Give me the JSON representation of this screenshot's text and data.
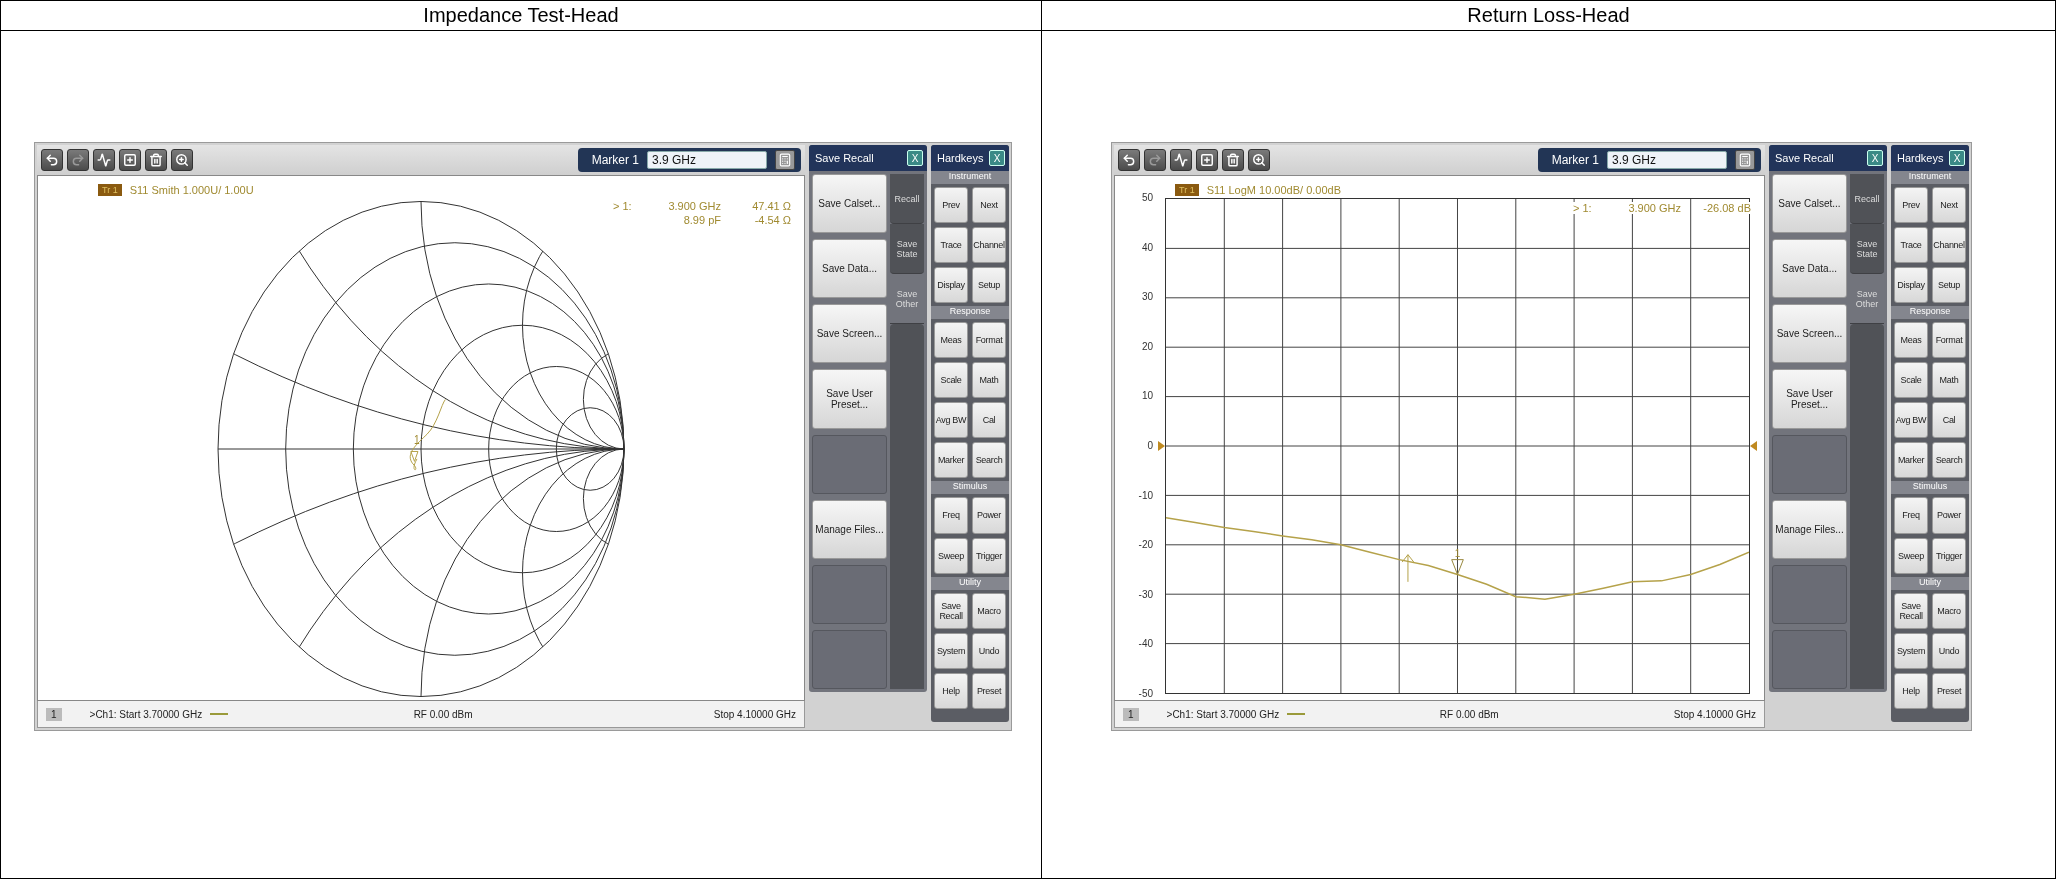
{
  "table": {
    "columns": [
      {
        "heading": "Impedance Test-Head",
        "screen": {
          "marker_label": "Marker 1",
          "marker_value": "3.9 GHz",
          "trace_tag": "Tr 1",
          "trace_title": "S11 Smith 1.000U/ 1.00U",
          "readout": [
            {
              "marker": "> 1:",
              "stimulus": "3.900  GHz",
              "value": "47.41 Ω"
            },
            {
              "stimulus": "8.99 pF",
              "value": "-4.54 Ω"
            }
          ],
          "display": {
            "kind": "smith",
            "marker_id": "1"
          },
          "status": {
            "channel": "1",
            "start": ">Ch1:  Start  3.70000 GHz",
            "rf": "RF   0.00 dBm",
            "stop": "Stop  4.10000 GHz"
          },
          "save_recall": {
            "title": "Save Recall",
            "close": "X",
            "buttons": [
              {
                "kind": "label",
                "label": "Save Calset..."
              },
              {
                "kind": "label",
                "label": "Save Data..."
              },
              {
                "kind": "label",
                "label": "Save Screen..."
              },
              {
                "kind": "label",
                "label": "Save User Preset..."
              },
              {
                "kind": "blank"
              },
              {
                "kind": "label",
                "label": "Manage Files..."
              },
              {
                "kind": "blank"
              },
              {
                "kind": "blank"
              }
            ],
            "tabs": [
              {
                "label": "Recall",
                "selected": false
              },
              {
                "label": "Save State",
                "selected": false
              },
              {
                "label": "Save Other",
                "selected": true
              }
            ]
          },
          "hardkeys": {
            "title": "Hardkeys",
            "close": "X",
            "groups": [
              {
                "name": "Instrument",
                "keys": [
                  "Prev",
                  "Next",
                  "Trace",
                  "Channel",
                  "Display",
                  "Setup"
                ]
              },
              {
                "name": "Response",
                "keys": [
                  "Meas",
                  "Format",
                  "Scale",
                  "Math",
                  "Avg BW",
                  "Cal",
                  "Marker",
                  "Search"
                ]
              },
              {
                "name": "Stimulus",
                "keys": [
                  "Freq",
                  "Power",
                  "Sweep",
                  "Trigger"
                ]
              },
              {
                "name": "Utility",
                "keys": [
                  "Save Recall",
                  "Macro",
                  "System",
                  "Undo",
                  "Help",
                  "Preset"
                ]
              }
            ]
          }
        }
      },
      {
        "heading": "Return Loss-Head",
        "screen": {
          "marker_label": "Marker 1",
          "marker_value": "3.9 GHz",
          "trace_tag": "Tr 1",
          "trace_title": "S11 LogM 10.00dB/ 0.00dB",
          "readout": [
            {
              "marker": "> 1:",
              "stimulus": "3.900  GHz",
              "value": "-26.08 dB"
            }
          ],
          "display": {
            "kind": "logmag",
            "marker_id": "1",
            "chart_data": {
              "type": "line",
              "categories": [
                null,
                null,
                null,
                null,
                null,
                null,
                null,
                null,
                null,
                null,
                null,
                null,
                null,
                null,
                null,
                null,
                null,
                null,
                null,
                null,
                null
              ],
              "series": [
                {
                  "color": "#b5a24a",
                  "values": [
                    -14.5,
                    -15.5,
                    -16.5,
                    -17.3,
                    -18.2,
                    -19,
                    -20,
                    -21.5,
                    -23,
                    -24.2,
                    -26,
                    -28,
                    -30.5,
                    -31,
                    -30,
                    -28.8,
                    -27.5,
                    -27.3,
                    -26,
                    -24,
                    -21.5
                  ]
                }
              ],
              "grid": true,
              "ylim": [
                -50,
                50
              ],
              "yticks": [
                50,
                40,
                30,
                20,
                10,
                0,
                -10,
                -20,
                -30,
                -40,
                -50
              ]
            }
          },
          "status": {
            "channel": "1",
            "start": ">Ch1:  Start  3.70000 GHz",
            "rf": "RF   0.00 dBm",
            "stop": "Stop  4.10000 GHz"
          },
          "save_recall": {
            "title": "Save Recall",
            "close": "X",
            "buttons": [
              {
                "kind": "label",
                "label": "Save Calset..."
              },
              {
                "kind": "label",
                "label": "Save Data..."
              },
              {
                "kind": "label",
                "label": "Save Screen..."
              },
              {
                "kind": "label",
                "label": "Save User Preset..."
              },
              {
                "kind": "blank"
              },
              {
                "kind": "label",
                "label": "Manage Files..."
              },
              {
                "kind": "blank"
              },
              {
                "kind": "blank"
              }
            ],
            "tabs": [
              {
                "label": "Recall",
                "selected": false
              },
              {
                "label": "Save State",
                "selected": false
              },
              {
                "label": "Save Other",
                "selected": true
              }
            ]
          },
          "hardkeys": {
            "title": "Hardkeys",
            "close": "X",
            "groups": [
              {
                "name": "Instrument",
                "keys": [
                  "Prev",
                  "Next",
                  "Trace",
                  "Channel",
                  "Display",
                  "Setup"
                ]
              },
              {
                "name": "Response",
                "keys": [
                  "Meas",
                  "Format",
                  "Scale",
                  "Math",
                  "Avg BW",
                  "Cal",
                  "Marker",
                  "Search"
                ]
              },
              {
                "name": "Stimulus",
                "keys": [
                  "Freq",
                  "Power",
                  "Sweep",
                  "Trigger"
                ]
              },
              {
                "name": "Utility",
                "keys": [
                  "Save Recall",
                  "Macro",
                  "System",
                  "Undo",
                  "Help",
                  "Preset"
                ]
              }
            ]
          }
        }
      }
    ]
  }
}
